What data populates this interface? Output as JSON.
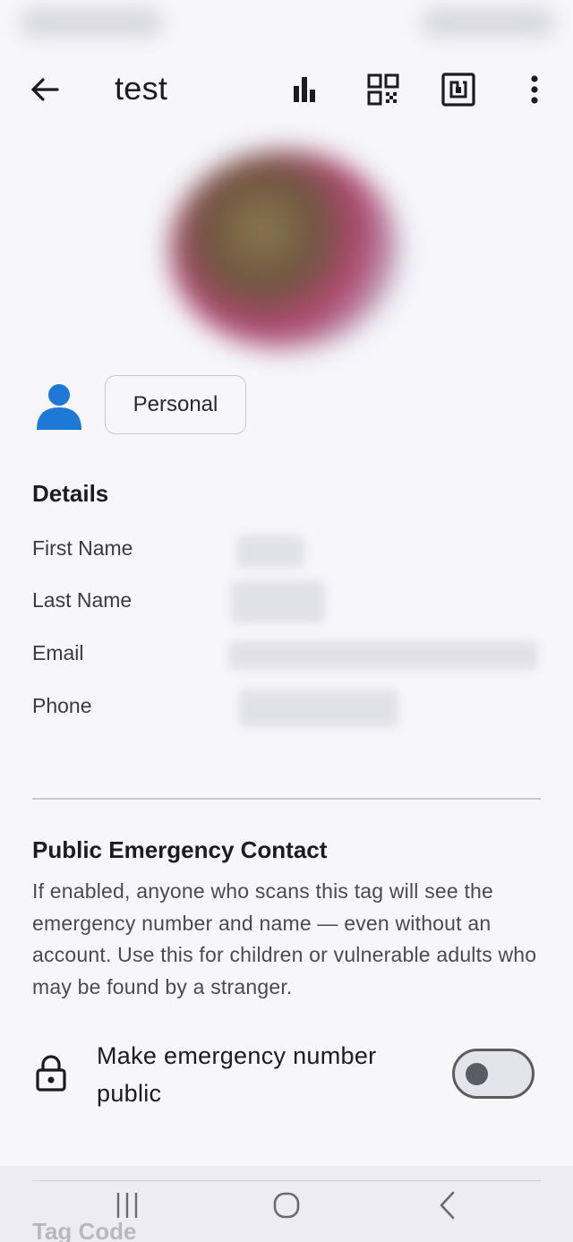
{
  "app_bar": {
    "title": "test",
    "back_icon": "arrow-left-icon",
    "actions": [
      "bar-chart-icon",
      "qr-code-icon",
      "nfc-tag-icon",
      "more-vert-icon"
    ]
  },
  "profile": {
    "category_icon": "person-icon",
    "category_label": "Personal"
  },
  "details": {
    "heading": "Details",
    "fields": [
      {
        "label": "First Name"
      },
      {
        "label": "Last Name"
      },
      {
        "label": "Email"
      },
      {
        "label": "Phone"
      }
    ]
  },
  "emergency": {
    "heading": "Public Emergency Contact",
    "description": "If enabled, anyone who scans this tag will see the emergency number and name — even without an account. Use this for children or vulnerable adults who may be found by a stranger.",
    "toggle_label": "Make emergency number public",
    "toggle_on": false,
    "lock_icon": "lock-icon"
  },
  "bottom": {
    "next_section_heading": "Tag Code",
    "nav": [
      "recent-apps-icon",
      "home-icon",
      "back-icon"
    ]
  },
  "colors": {
    "background": "#f6f6fb",
    "accent_person": "#1e78d6",
    "toggle_outline": "#5c5b63"
  }
}
